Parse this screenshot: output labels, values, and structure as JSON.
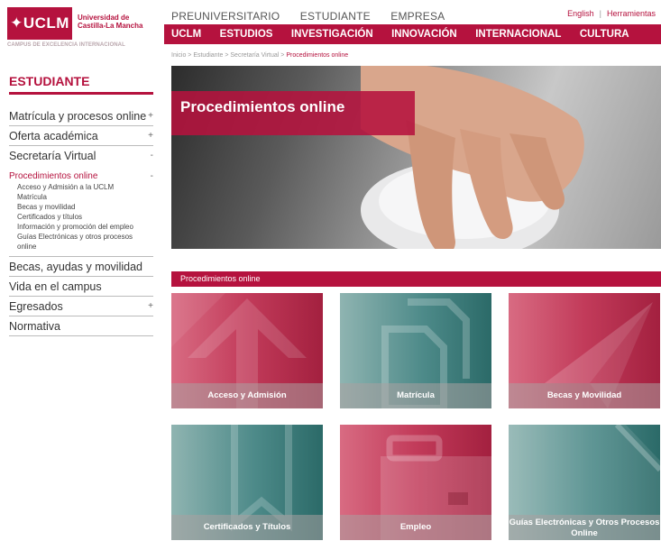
{
  "logo": {
    "text": "UCLM",
    "university": "Universidad de Castilla-La Mancha",
    "tagline": "CAMPUS DE EXCELENCIA INTERNACIONAL"
  },
  "topnav": [
    "PREUNIVERSITARIO",
    "ESTUDIANTE",
    "EMPRESA"
  ],
  "toolnav": {
    "english": "English",
    "separator": "|",
    "tools": "Herramientas"
  },
  "mainnav": [
    "UCLM",
    "ESTUDIOS",
    "INVESTIGACIÓN",
    "INNOVACIÓN",
    "INTERNACIONAL",
    "CULTURA"
  ],
  "breadcrumb": {
    "path": "Inicio > Estudiante > Secretaría Virtual > ",
    "current": "Procedimientos online"
  },
  "sidebar": {
    "title": "ESTUDIANTE",
    "items": [
      {
        "label": "Matrícula y procesos online",
        "sign": "+"
      },
      {
        "label": "Oferta académica",
        "sign": "+"
      },
      {
        "label": "Secretaría Virtual",
        "sign": "-"
      },
      {
        "label": "Procedimientos online",
        "sign": "-"
      },
      {
        "label": "Becas, ayudas y movilidad",
        "sign": ""
      },
      {
        "label": "Vida en el campus",
        "sign": ""
      },
      {
        "label": "Egresados",
        "sign": "+"
      },
      {
        "label": "Normativa",
        "sign": ""
      }
    ],
    "subitems": [
      "Acceso y Admisión a la UCLM",
      "Matrícula",
      "Becas y movilidad",
      "Certificados y títulos",
      "Información y promoción del empleo",
      "Guías Electrónicas y otros procesos online"
    ]
  },
  "hero": {
    "title": "Procedimientos online"
  },
  "section": {
    "title": "Procedimientos online"
  },
  "tiles": [
    {
      "label": "Acceso y Admisión",
      "color": "red",
      "icon": "arrow-up-icon"
    },
    {
      "label": "Matrícula",
      "color": "teal",
      "icon": "documents-icon"
    },
    {
      "label": "Becas y Movilidad",
      "color": "red",
      "icon": "paper-plane-icon"
    },
    {
      "label": "Certificados y Títulos",
      "color": "teal",
      "icon": "ribbon-bookmark-icon"
    },
    {
      "label": "Empleo",
      "color": "red",
      "icon": "briefcase-icon"
    },
    {
      "label": "Guías Electrónicas y Otros Procesos Online",
      "color": "teal",
      "icon": "document-corner-icon"
    }
  ],
  "colors": {
    "brand": "#b5123e",
    "teal": "#4d8a89"
  }
}
